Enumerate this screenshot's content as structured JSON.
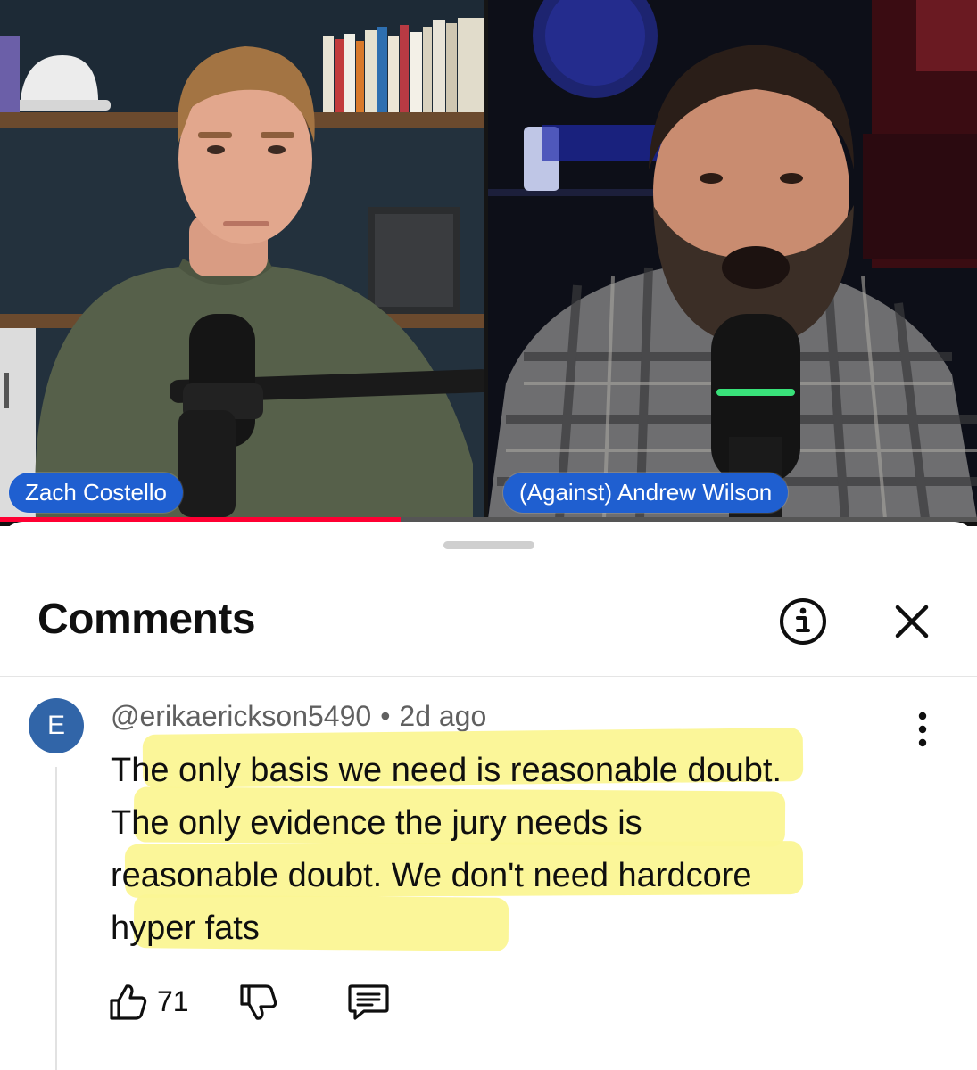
{
  "video": {
    "left_speaker": "Zach Costello",
    "right_speaker": "(Against) Andrew Wilson",
    "progress_fraction": 0.41,
    "accent_color": "#1f5fd0",
    "progress_color": "#ff0033"
  },
  "comments_panel": {
    "title": "Comments",
    "info_icon": "info-icon",
    "close_icon": "close-icon"
  },
  "comment": {
    "avatar_letter": "E",
    "avatar_color": "#3165a8",
    "author": "@erikaerickson5490",
    "separator": "•",
    "time": "2d ago",
    "lines": [
      "The only basis we need is reasonable doubt.",
      "The only evidence the jury needs is",
      "reasonable doubt. We don't need hardcore",
      "hyper fats"
    ],
    "highlight_color": "#fbf693",
    "likes": "71",
    "like_icon": "thumbs-up-icon",
    "dislike_icon": "thumbs-down-icon",
    "reply_icon": "reply-icon",
    "more_icon": "more-vertical-icon"
  }
}
